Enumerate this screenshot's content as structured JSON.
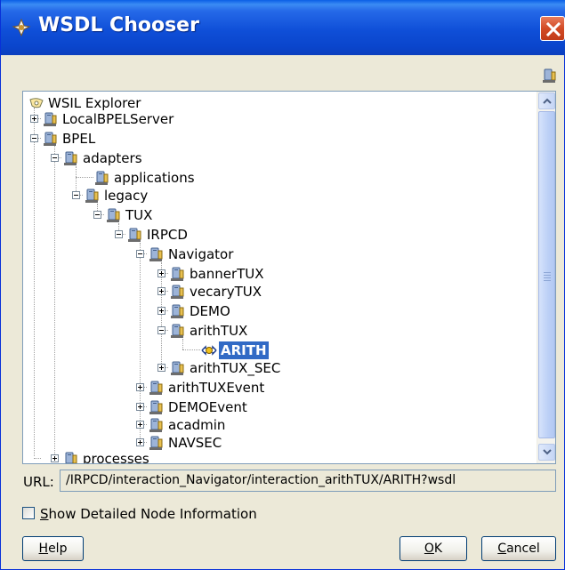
{
  "window": {
    "title": "WSDL Chooser"
  },
  "tree": {
    "nodes": [
      {
        "label": "WSIL Explorer",
        "icon": "wsil-explorer-icon"
      },
      {
        "label": "LocalBPELServer",
        "icon": "server-icon"
      },
      {
        "label": "BPEL",
        "icon": "server-icon"
      },
      {
        "label": "adapters",
        "icon": "server-icon"
      },
      {
        "label": "applications",
        "icon": "server-icon"
      },
      {
        "label": "legacy",
        "icon": "server-icon"
      },
      {
        "label": "TUX",
        "icon": "server-icon"
      },
      {
        "label": "IRPCD",
        "icon": "server-icon"
      },
      {
        "label": "Navigator",
        "icon": "server-icon"
      },
      {
        "label": "bannerTUX",
        "icon": "server-icon"
      },
      {
        "label": "vecaryTUX",
        "icon": "server-icon"
      },
      {
        "label": "DEMO",
        "icon": "server-icon"
      },
      {
        "label": "arithTUX",
        "icon": "server-icon"
      },
      {
        "label": "ARITH",
        "icon": "wsdl-port-icon",
        "selected": true
      },
      {
        "label": "arithTUX_SEC",
        "icon": "server-icon"
      },
      {
        "label": "arithTUXEvent",
        "icon": "server-icon"
      },
      {
        "label": "DEMOEvent",
        "icon": "server-icon"
      },
      {
        "label": "acadmin",
        "icon": "server-icon"
      },
      {
        "label": "NAVSEC",
        "icon": "server-icon"
      },
      {
        "label": "processes",
        "icon": "server-icon"
      }
    ]
  },
  "url": {
    "label": "URL:",
    "value": "/IRPCD/interaction_Navigator/interaction_arithTUX/ARITH?wsdl"
  },
  "options": {
    "detailed_mnemonic": "S",
    "detailed_rest": "how Detailed Node Information",
    "detailed_checked": false
  },
  "buttons": {
    "help_mnemonic": "H",
    "help_rest": "elp",
    "ok_mnemonic": "O",
    "ok_rest": "K",
    "cancel_mnemonic": "C",
    "cancel_rest": "ancel"
  },
  "colors": {
    "title_bar": "#0a45cc",
    "selection": "#316ac5",
    "close_button": "#d24b26"
  }
}
